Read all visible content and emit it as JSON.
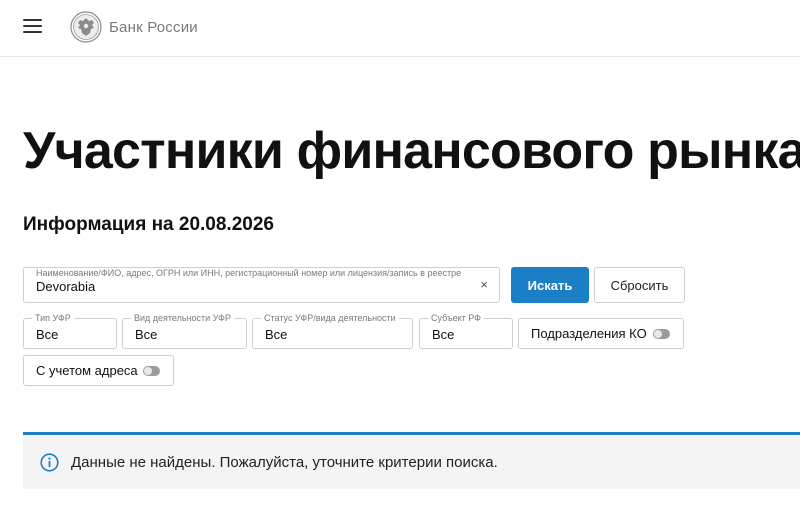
{
  "header": {
    "menu_icon": "hamburger-menu-icon",
    "logo_icon": "eagle-emblem-icon",
    "logo_text": "Банк России"
  },
  "page": {
    "title": "Участники финансового рынка",
    "info_date": "Информация на 20.08.2026"
  },
  "search": {
    "label": "Наименование/ФИО, адрес, ОГРН или ИНН, регистрационный номер или лицензия/запись в реестре",
    "value": "Devorabia",
    "clear_symbol": "×",
    "search_button": "Искать",
    "reset_button": "Сбросить"
  },
  "filters": {
    "type_label": "Тип УФР",
    "type_value": "Все",
    "activity_label": "Вид деятельности УФР",
    "activity_value": "Все",
    "status_label": "Статус УФР/вида деятельности",
    "status_value": "Все",
    "subject_label": "Субъект РФ",
    "subject_value": "Все",
    "divisions_toggle_label": "Подразделения КО",
    "divisions_toggle_on": false,
    "address_toggle_label": "С учетом адреса",
    "address_toggle_on": false
  },
  "alert": {
    "icon": "info-icon",
    "text": "Данные не найдены. Пожалуйста, уточните критерии поиска.",
    "accent_color": "#1b7fc6"
  },
  "colors": {
    "primary": "#1b7fc6",
    "border": "#cfcfcf",
    "alert_bg": "#f4f4f4"
  }
}
